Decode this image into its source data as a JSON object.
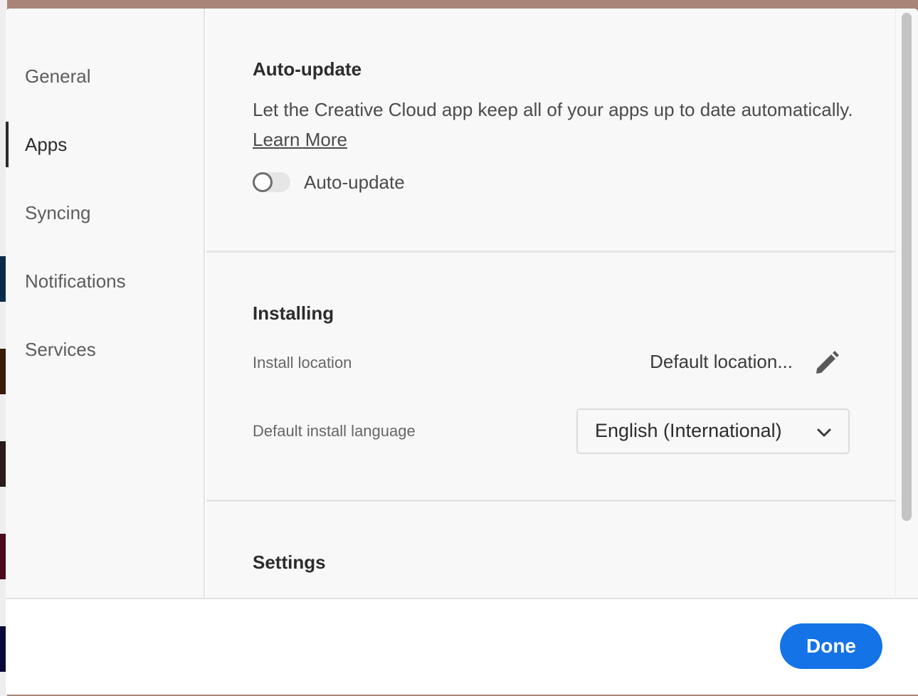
{
  "colors": {
    "accent": "#1473e6",
    "background_app": "#a98478",
    "panel": "#f8f8f8",
    "active_indicator": "#2b2b2b"
  },
  "sidebar": {
    "items": [
      {
        "label": "General",
        "active": false
      },
      {
        "label": "Apps",
        "active": true
      },
      {
        "label": "Syncing",
        "active": false
      },
      {
        "label": "Notifications",
        "active": false
      },
      {
        "label": "Services",
        "active": false
      }
    ]
  },
  "auto_update": {
    "title": "Auto-update",
    "description": "Let the Creative Cloud app keep all of your apps up to date automatically.",
    "link": "Learn More",
    "toggle_label": "Auto-update",
    "toggle_on": false
  },
  "installing": {
    "title": "Installing",
    "location_label": "Install location",
    "location_value": "Default location...",
    "edit_icon": "pencil-icon",
    "language_label": "Default install language",
    "language_value": "English (International)",
    "dropdown_icon": "chevron-down-icon"
  },
  "settings": {
    "title": "Settings"
  },
  "footer": {
    "done_label": "Done"
  }
}
